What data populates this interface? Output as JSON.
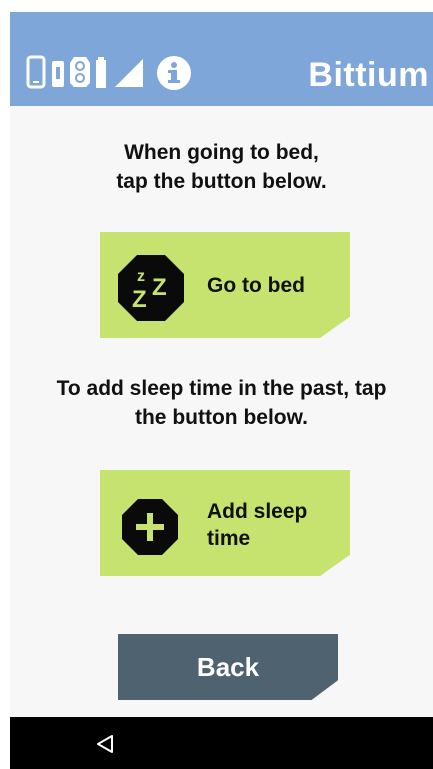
{
  "header": {
    "brand": "Bittium",
    "background_color": "#7fa6d8",
    "status_icons": [
      "device-icon",
      "connection-icon",
      "sensor-icon",
      "battery-icon",
      "signal-icon",
      "info-icon"
    ]
  },
  "main": {
    "bed_prompt_line1": "When going to bed,",
    "bed_prompt_line2": "tap the button below.",
    "go_to_bed_label": "Go to bed",
    "past_prompt_line1": "To add sleep time in the past, tap",
    "past_prompt_line2": "the button below.",
    "add_sleep_label_line1": "Add sleep",
    "add_sleep_label_line2": "time",
    "button_color": "#c7e36f"
  },
  "footer": {
    "back_label": "Back",
    "back_button_color": "#4e6270"
  },
  "navbar": {
    "icons": [
      "nav-back-icon"
    ]
  }
}
